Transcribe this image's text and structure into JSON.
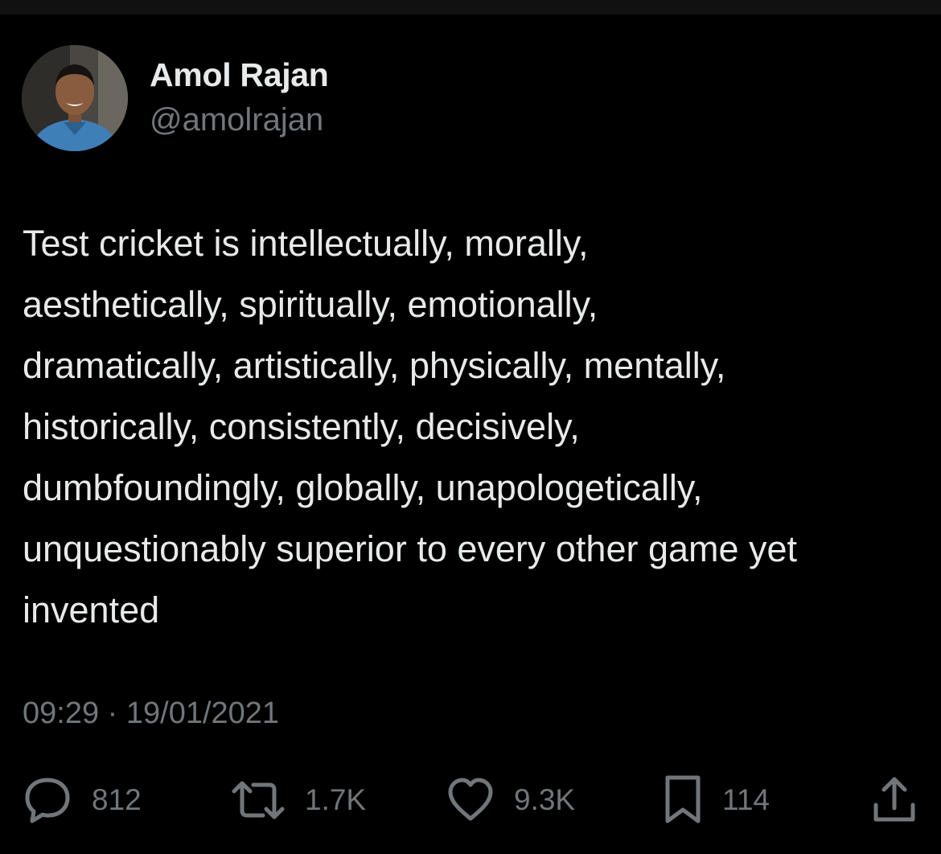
{
  "author": {
    "name": "Amol Rajan",
    "handle": "@amolrajan"
  },
  "tweet": {
    "lines": [
      "Test cricket is intellectually, morally,",
      "aesthetically, spiritually, emotionally,",
      "dramatically, artistically, physically, mentally,",
      "historically, consistently, decisively,",
      "dumbfoundingly, globally, unapologetically,",
      "unquestionably superior to every other game yet",
      "invented"
    ],
    "timestamp": "09:29 · 19/01/2021"
  },
  "actions": {
    "replies": "812",
    "retweets": "1.7K",
    "likes": "9.3K",
    "bookmarks": "114"
  },
  "icons": {
    "reply": "speech-bubble-icon",
    "retweet": "retweet-arrows-icon",
    "like": "heart-icon",
    "bookmark": "bookmark-icon",
    "share": "share-upload-icon"
  },
  "colors": {
    "background": "#000000",
    "text": "#e7e9ea",
    "secondary": "#71767b"
  }
}
